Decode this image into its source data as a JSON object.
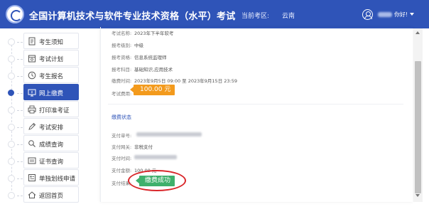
{
  "header": {
    "app_title": "全国计算机技术与软件专业技术资格（水平）考试",
    "region_label": "当前考区:",
    "region_value": "云南",
    "user_suffix": "你好!",
    "brand_color": "#2f54b8"
  },
  "sidebar": {
    "items": [
      {
        "label": "考生须知",
        "icon": "document-icon",
        "active": false
      },
      {
        "label": "考试计划",
        "icon": "calendar-icon",
        "active": false
      },
      {
        "label": "考生报名",
        "icon": "clock-icon",
        "active": false
      },
      {
        "label": "网上缴费",
        "icon": "payment-icon",
        "active": true
      },
      {
        "label": "打印准考证",
        "icon": "printer-icon",
        "active": false
      },
      {
        "label": "考试安排",
        "icon": "pencil-icon",
        "active": false
      },
      {
        "label": "成绩查询",
        "icon": "search-icon",
        "active": false
      },
      {
        "label": "证书查询",
        "icon": "certificate-icon",
        "active": false
      },
      {
        "label": "单独划线申请",
        "icon": "form-icon",
        "active": false
      },
      {
        "label": "返回首页",
        "icon": "home-icon",
        "active": false
      }
    ]
  },
  "exam_info": {
    "exam_name_label": "考试名称:",
    "exam_name": "2023年下半年软考",
    "level_label": "报考级别:",
    "level": "中级",
    "qualification_label": "报考资格:",
    "qualification": "信息系统监理师",
    "subjects_label": "报考科目:",
    "subjects": "基础知识,应用技术",
    "payment_time_label": "缴费时间:",
    "payment_time": "2023年9月5日 09:00 至 2023年9月15日 23:59",
    "fee_label": "考试费用:",
    "fee": "100.00 元",
    "fee_color": "#f39a1c"
  },
  "payment_status": {
    "section_title": "缴费状态",
    "order_no_label": "支付单号:",
    "gateway_label": "支付网关:",
    "gateway": "非税支付",
    "pay_time_label": "支付时间:",
    "amount_label": "支付金额:",
    "amount": "100.00 元",
    "result_label": "支付结果:",
    "result": "缴费成功",
    "result_color": "#3fb06c",
    "highlight_color": "#d9262a"
  }
}
